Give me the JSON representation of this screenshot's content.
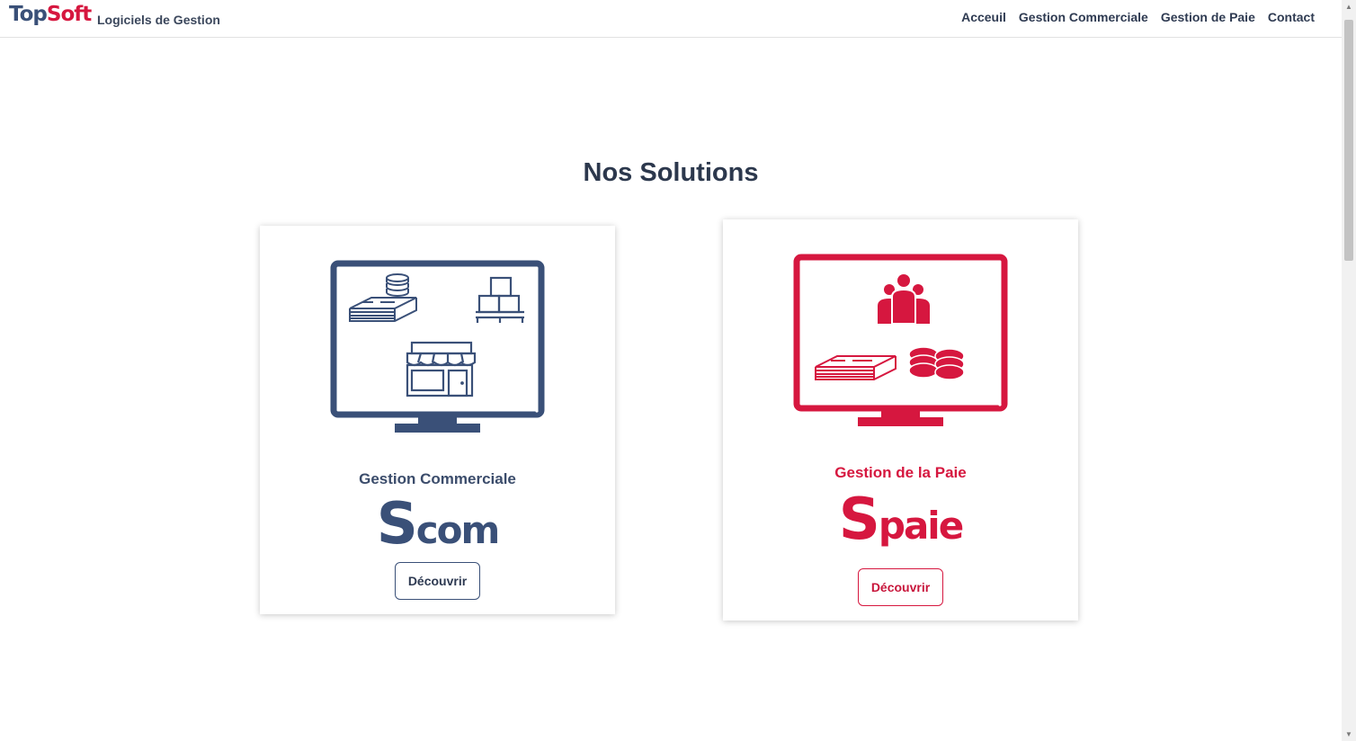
{
  "header": {
    "logo_top": "Top",
    "logo_soft": "Soft",
    "tagline": "Logiciels de Gestion",
    "nav": [
      "Acceuil",
      "Gestion Commerciale",
      "Gestion de Paie",
      "Contact"
    ]
  },
  "main": {
    "title": "Nos Solutions",
    "cards": [
      {
        "title": "Gestion Commerciale",
        "logo_initial": "S",
        "logo_rest": "com",
        "button": "Découvrir",
        "color": "#3a5078",
        "icons": [
          "money-stack-icon",
          "coins-icon",
          "pallet-boxes-icon",
          "storefront-icon",
          "monitor-icon"
        ]
      },
      {
        "title": "Gestion de la Paie",
        "logo_initial": "S",
        "logo_rest": "paie",
        "button": "Découvrir",
        "color": "#d6173f",
        "icons": [
          "team-icon",
          "money-stack-icon",
          "coins-icon",
          "monitor-icon"
        ]
      }
    ]
  }
}
